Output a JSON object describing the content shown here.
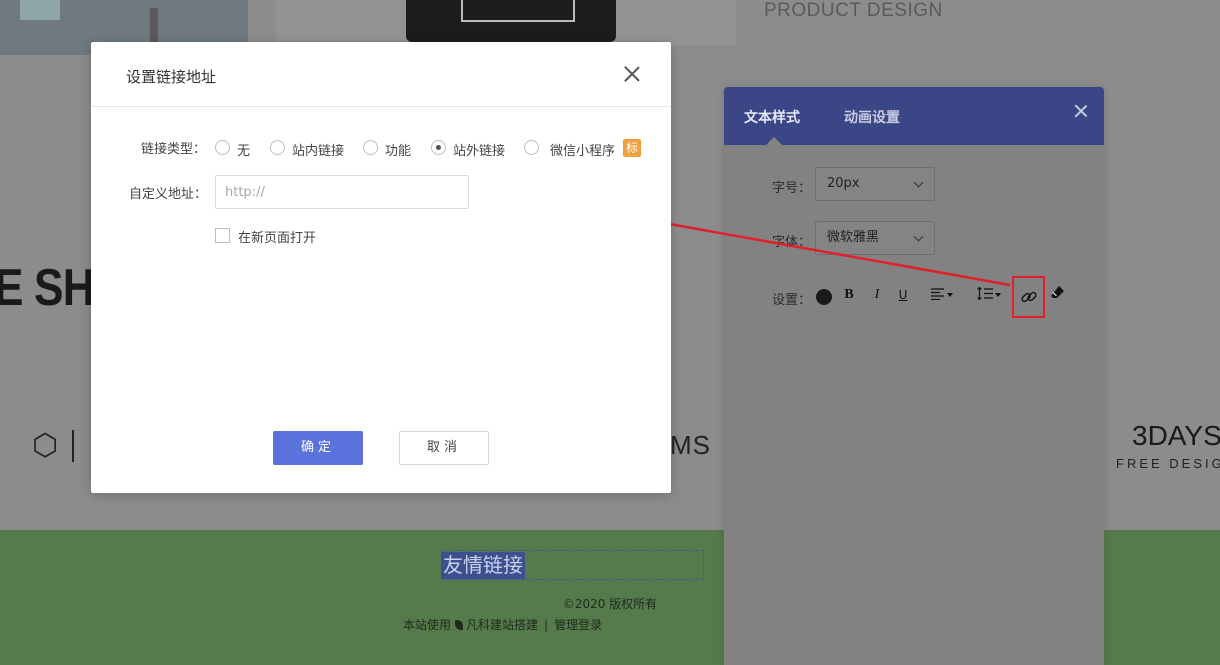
{
  "background": {
    "heading": "PRODUCT DESIGN",
    "shop_text": "E SHO",
    "logo_ms": "MS",
    "logo_3days": "3DAYS",
    "logo_3days_sub": "FREE DESIG"
  },
  "footer": {
    "friend_links": "友情链接",
    "copyright": "©2020 版权所有",
    "powered_prefix": "本站使用",
    "powered_brand": "凡科建站搭建",
    "separator": "|",
    "admin_login": "管理登录"
  },
  "panel": {
    "tabs": [
      {
        "label": "文本样式",
        "active": true
      },
      {
        "label": "动画设置",
        "active": false
      }
    ],
    "font_size_label": "字号：",
    "font_size_value": "20px",
    "font_family_label": "字体：",
    "font_family_value": "微软雅黑",
    "settings_label": "设置：",
    "toolbar": {
      "bold": "B",
      "italic": "I",
      "underline": "U",
      "align_icon": "align-left-icon",
      "line_height_icon": "line-height-icon",
      "link_icon": "link-icon",
      "eraser_icon": "eraser-icon",
      "color": "#1a1a1a"
    }
  },
  "modal": {
    "title": "设置链接地址",
    "link_type_label": "链接类型：",
    "link_types": [
      {
        "label": "无",
        "selected": false
      },
      {
        "label": "站内链接",
        "selected": false
      },
      {
        "label": "功能",
        "selected": false
      },
      {
        "label": "站外链接",
        "selected": true
      },
      {
        "label": "微信小程序",
        "selected": false
      }
    ],
    "badge": "标",
    "custom_url_label": "自定义地址：",
    "custom_url_placeholder": "http://",
    "custom_url_value": "",
    "new_page_label": "在新页面打开",
    "new_page_checked": false,
    "ok_label": "确定",
    "cancel_label": "取消"
  },
  "colors": {
    "primary_button": "#5a73dc",
    "panel_header": "#3a4685",
    "annotation_red": "#e0202b",
    "badge": "#f0a03c",
    "footer_bg": "#557a4b"
  }
}
